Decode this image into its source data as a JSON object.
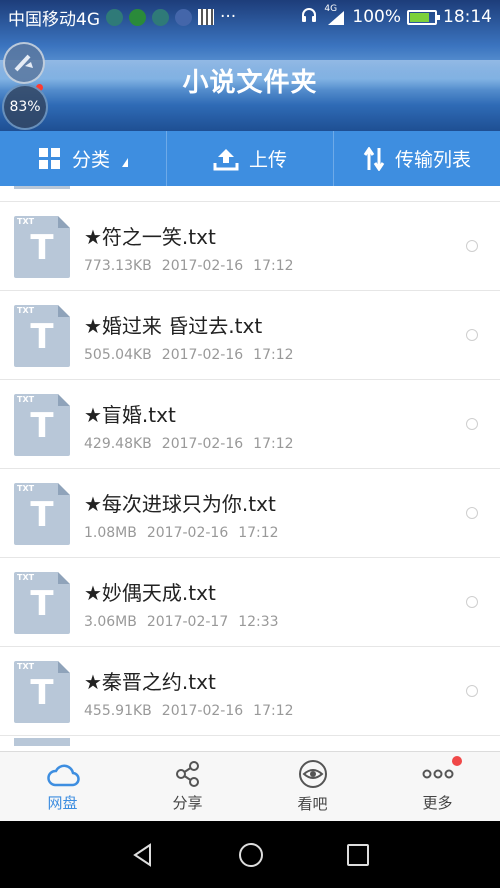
{
  "status_bar": {
    "carrier": "中国移动4G",
    "more": "···",
    "signal_label": "4G",
    "battery": "100%",
    "time": "18:14"
  },
  "floating_widget": {
    "percent": "83%"
  },
  "header": {
    "title": "小说文件夹"
  },
  "toolbar": {
    "category_label": "分类",
    "upload_label": "上传",
    "transfer_label": "传输列表"
  },
  "files": [
    {
      "name": "★符之一笑.txt",
      "size": "773.13KB",
      "date": "2017-02-16",
      "time": "17:12"
    },
    {
      "name": "★婚过来 昏过去.txt",
      "size": "505.04KB",
      "date": "2017-02-16",
      "time": "17:12"
    },
    {
      "name": "★盲婚.txt",
      "size": "429.48KB",
      "date": "2017-02-16",
      "time": "17:12"
    },
    {
      "name": "★每次进球只为你.txt",
      "size": "1.08MB",
      "date": "2017-02-16",
      "time": "17:12"
    },
    {
      "name": "★妙偶天成.txt",
      "size": "3.06MB",
      "date": "2017-02-17",
      "time": "12:33"
    },
    {
      "name": "★秦晋之约.txt",
      "size": "455.91KB",
      "date": "2017-02-16",
      "time": "17:12"
    }
  ],
  "file_type_tag": "TXT",
  "file_type_letter": "T",
  "bottom_nav": {
    "disk": "网盘",
    "share": "分享",
    "watch": "看吧",
    "more": "更多"
  },
  "colors": {
    "accent": "#3e8ee0",
    "file_icon": "#b8c7d8",
    "badge": "#f04848"
  }
}
